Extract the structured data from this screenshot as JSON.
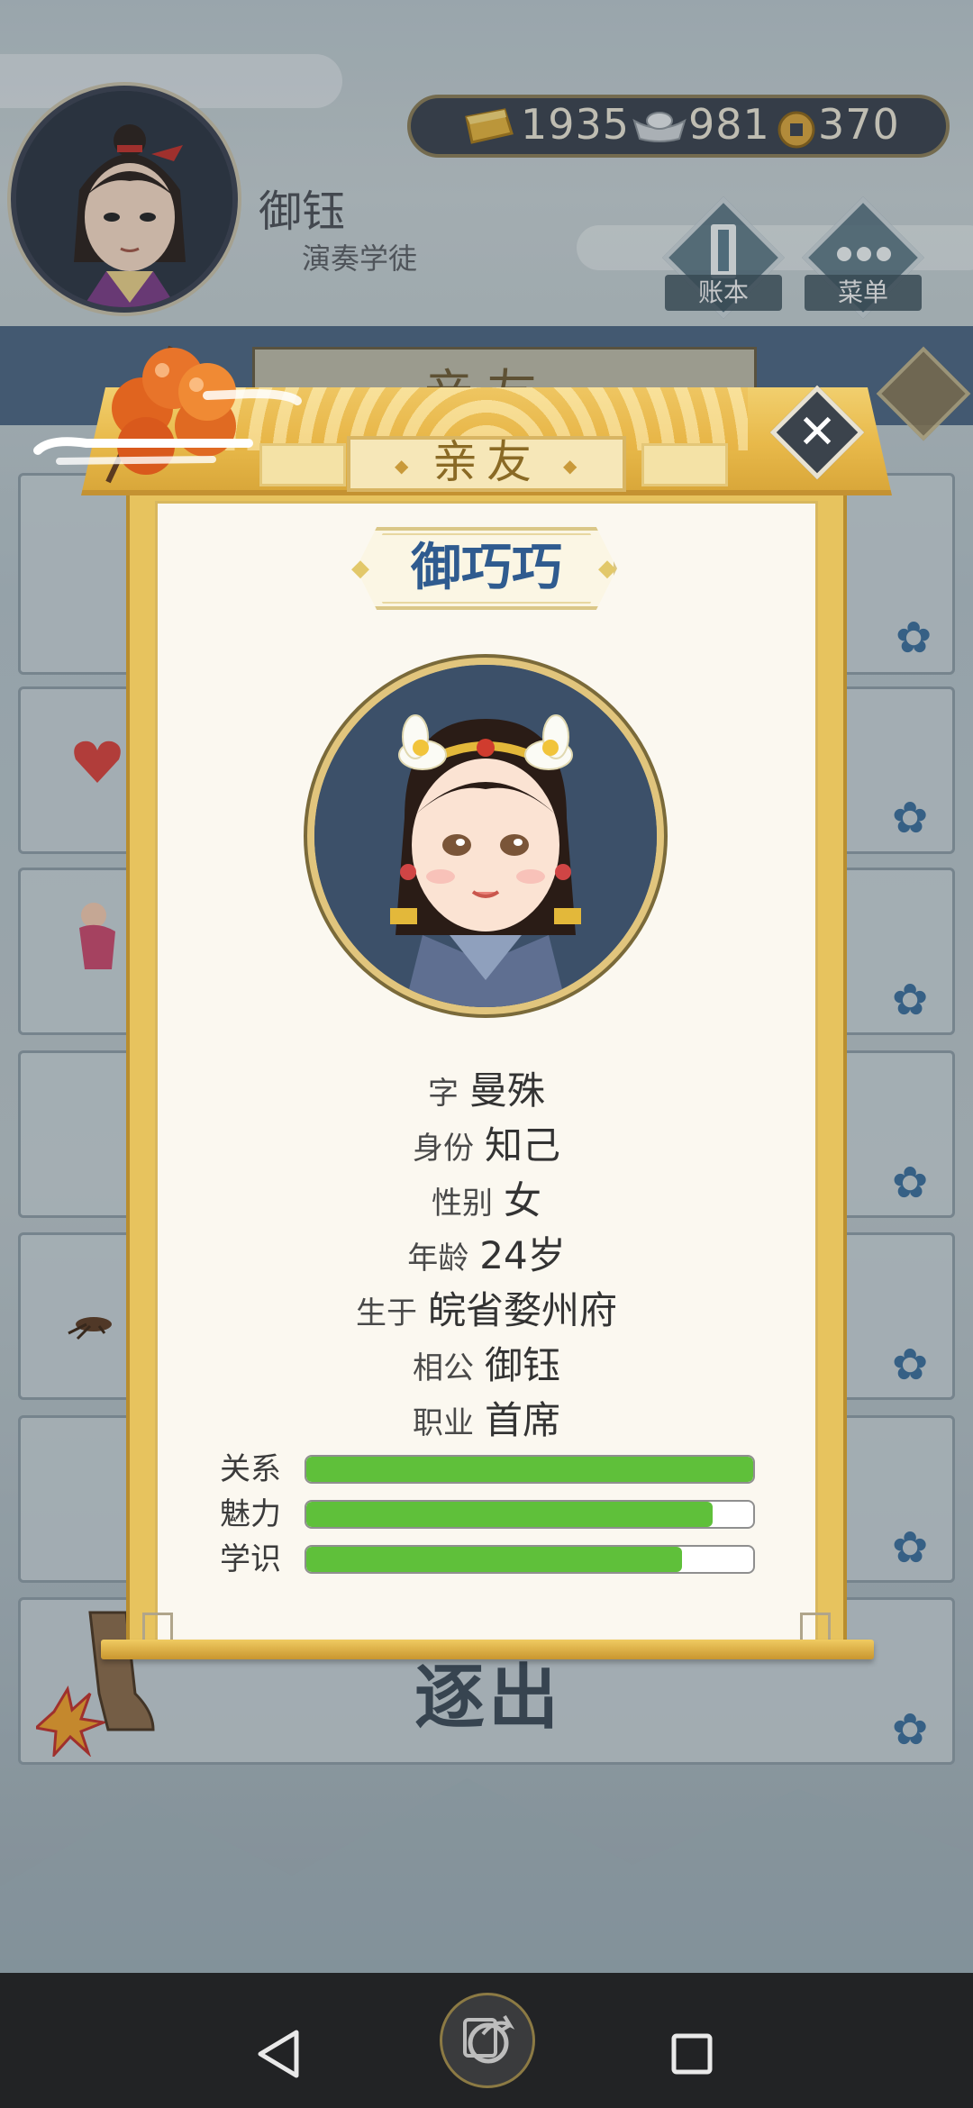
{
  "header": {
    "player_name": "御钰",
    "player_title": "演奏学徒",
    "currency": {
      "gold": "1935",
      "silver": "981",
      "coin": "370"
    },
    "ledger_label": "账本",
    "menu_label": "菜单"
  },
  "background": {
    "tab_title": "亲友",
    "exit_label": "逐出"
  },
  "modal": {
    "tab_title": "亲友",
    "npc_name": "御巧巧",
    "info": [
      {
        "label": "字",
        "value": "曼殊"
      },
      {
        "label": "身份",
        "value": "知己"
      },
      {
        "label": "性别",
        "value": "女"
      },
      {
        "label": "年龄",
        "value": "24岁"
      },
      {
        "label": "生于",
        "value": "皖省婺州府"
      },
      {
        "label": "相公",
        "value": "御钰"
      },
      {
        "label": "职业",
        "value": "首席"
      }
    ],
    "stats": [
      {
        "label": "关系",
        "value": 1.0
      },
      {
        "label": "魅力",
        "value": 0.91
      },
      {
        "label": "学识",
        "value": 0.84
      }
    ]
  },
  "colors": {
    "stat_fill": "#5fc03a",
    "npc_name": "#2f5b8f",
    "scroll_gold": "#e7c35e"
  }
}
